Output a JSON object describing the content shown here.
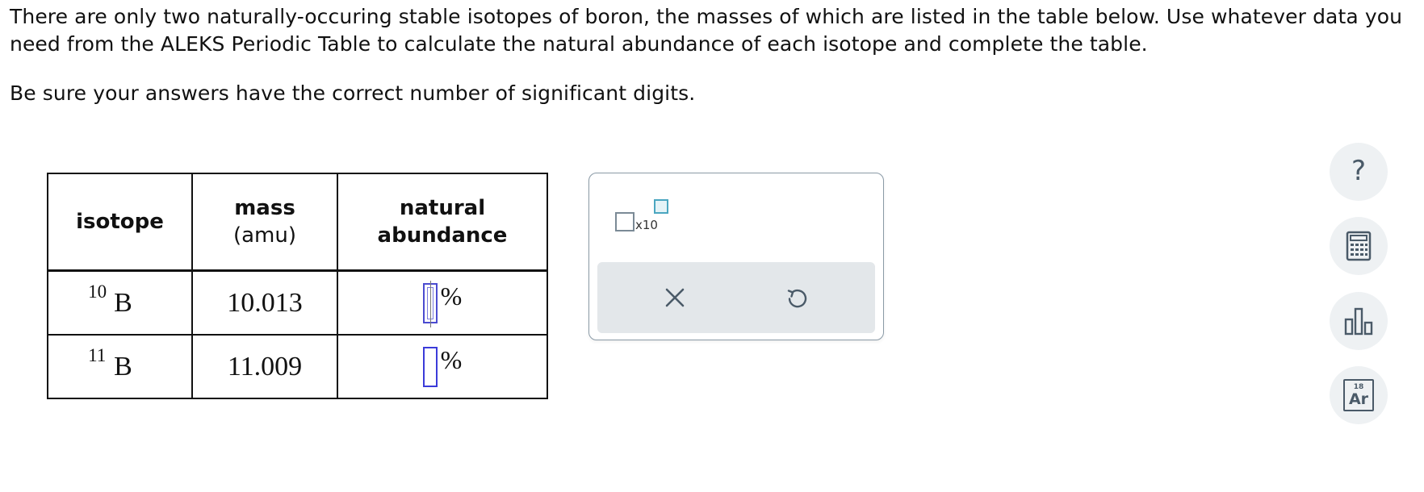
{
  "problem": {
    "paragraph1": "There are only two naturally-occuring stable isotopes of boron, the masses of which are listed in the table below. Use whatever data you need from the ALEKS Periodic Table to calculate the natural abundance of each isotope and complete the table.",
    "paragraph2": "Be sure your answers have the correct number of significant digits."
  },
  "table": {
    "headers": {
      "isotope": "isotope",
      "mass_top": "mass",
      "mass_unit": "(amu)",
      "abundance_top": "natural",
      "abundance_bottom": "abundance"
    },
    "rows": [
      {
        "mass_number": "10",
        "symbol": "B",
        "mass": "10.013",
        "abundance_value": "",
        "unit": "%"
      },
      {
        "mass_number": "11",
        "symbol": "B",
        "mass": "11.009",
        "abundance_value": "",
        "unit": "%"
      }
    ]
  },
  "tool_panel": {
    "sci_notation_label": "x10",
    "clear_icon": "close-icon",
    "undo_icon": "undo-icon"
  },
  "side_tools": {
    "help_glyph": "?",
    "calculator_icon": "calculator-icon",
    "data_icon": "bar-chart-icon",
    "periodic_number": "18",
    "periodic_symbol": "Ar"
  },
  "colors": {
    "answer_box_border": "#3b3bd9",
    "panel_border": "#8a9aa6",
    "tool_bar_bg": "#e3e7ea",
    "side_button_bg": "#eef1f3",
    "icon_color": "#4a5a68",
    "exponent_box": "#4aa6c0"
  }
}
